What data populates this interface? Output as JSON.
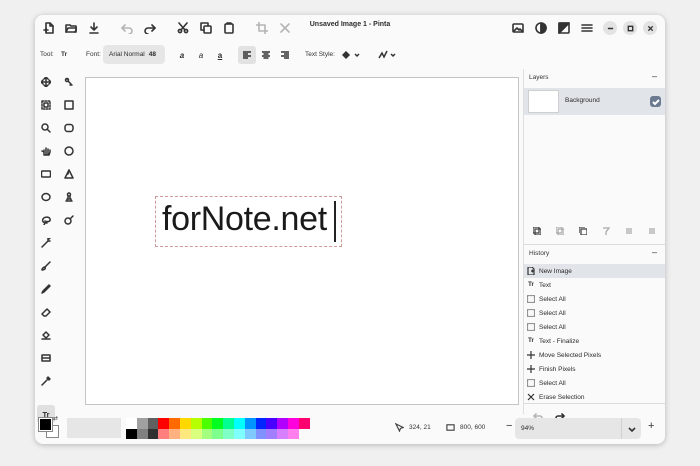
{
  "window": {
    "title": "Unsaved Image 1 - Pinta"
  },
  "toolbar": {
    "tool_label": "Tool:",
    "tool_value": "Tr",
    "font_label": "Font:",
    "font_name": "Arial Normal",
    "font_size": "48",
    "text_style_label": "Text Style:",
    "alignment": "left"
  },
  "canvas": {
    "text": "forNote.net"
  },
  "layers": {
    "title": "Layers",
    "collapse": "–",
    "items": [
      {
        "name": "Background",
        "visible": true
      }
    ]
  },
  "history": {
    "title": "History",
    "collapse": "–",
    "items": [
      {
        "label": "New Image",
        "icon": "new-image-icon",
        "selected": true
      },
      {
        "label": "Text",
        "icon": "text-icon"
      },
      {
        "label": "Select All",
        "icon": "select-all-icon"
      },
      {
        "label": "Select All",
        "icon": "select-all-icon"
      },
      {
        "label": "Select All",
        "icon": "select-all-icon"
      },
      {
        "label": "Text - Finalize",
        "icon": "text-icon"
      },
      {
        "label": "Move Selected Pixels",
        "icon": "move-icon"
      },
      {
        "label": "Finish Pixels",
        "icon": "move-icon"
      },
      {
        "label": "Select All",
        "icon": "select-all-icon"
      },
      {
        "label": "Erase Selection",
        "icon": "erase-selection-icon"
      }
    ]
  },
  "statusbar": {
    "cursor_position": "324, 21",
    "image_size": "800, 600",
    "zoom": "94%",
    "zoom_out": "−",
    "zoom_in": "+"
  },
  "colors": {
    "primary": "#000000",
    "secondary": "#ffffff",
    "palette": [
      "#ffffff",
      "#a0a0a0",
      "#606060",
      "#ff0000",
      "#ff6a00",
      "#ffd800",
      "#b6ff00",
      "#4cff00",
      "#00ff21",
      "#00ff90",
      "#00ffff",
      "#0094ff",
      "#0026ff",
      "#4800ff",
      "#b200ff",
      "#ff00dc",
      "#ff006e",
      "#000000",
      "#808080",
      "#303030",
      "#ff7f7f",
      "#ffb27f",
      "#ffe97f",
      "#daff7f",
      "#a5ff7f",
      "#7fff8e",
      "#7fffc5",
      "#7fffff",
      "#7fc9ff",
      "#7f92ff",
      "#a17fff",
      "#d67fff",
      "#ff7fed"
    ]
  }
}
